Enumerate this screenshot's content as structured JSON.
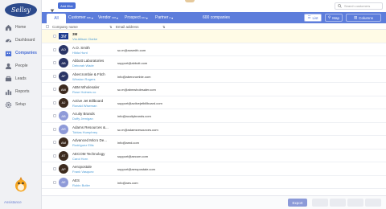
{
  "app": {
    "logo_text": "Sellsy",
    "help_link": "Assistance"
  },
  "sidebar": {
    "items": [
      {
        "label": "Home",
        "icon": "home-icon"
      },
      {
        "label": "Dashboard",
        "icon": "dashboard-icon"
      },
      {
        "label": "Companies",
        "icon": "companies-icon",
        "active": true
      },
      {
        "label": "People",
        "icon": "people-icon"
      },
      {
        "label": "Leads",
        "icon": "leads-icon"
      },
      {
        "label": "Reports",
        "icon": "reports-icon"
      },
      {
        "label": "Setup",
        "icon": "setup-icon"
      }
    ]
  },
  "toolbar": {
    "add_filter": "Add filter",
    "search_placeholder": "Search customers"
  },
  "tabs": [
    {
      "label": "All",
      "badge": ""
    },
    {
      "label": "Customer",
      "badge": "436"
    },
    {
      "label": "Vendor",
      "badge": "138"
    },
    {
      "label": "Prospect",
      "badge": "104"
    },
    {
      "label": "Partner",
      "badge": "2"
    }
  ],
  "count_label": "600 companies",
  "views": {
    "list": "List",
    "map": "Map",
    "columns": "Columns"
  },
  "table": {
    "columns": [
      "Company name",
      "Email address"
    ],
    "rows": [
      {
        "name": "3M",
        "contact": "Via Allison Clarke",
        "email": "",
        "avatar": "3M"
      },
      {
        "name": "A.O. Smith",
        "contact": "Hilda Hunt",
        "email": "sc.m@aosmith.com",
        "avatar": "AO"
      },
      {
        "name": "Abbott Laboratories",
        "contact": "Deborah Wade",
        "email": "support@abbott.com",
        "avatar": "AB"
      },
      {
        "name": "Abercrombie & Fitch",
        "contact": "Winston Rogers",
        "email": "info@abercrombie.com",
        "avatar": "AF"
      },
      {
        "name": "ABM Wholesaler",
        "contact": "Rose Holmes co",
        "email": "sc.m@abmwholesaler.com",
        "avatar": "AW"
      },
      {
        "name": "Active Jet Billboard",
        "contact": "Ronald Wiseman",
        "email": "support@activejetbillboard.com",
        "avatar": "AJ"
      },
      {
        "name": "Acuity Brands",
        "contact": "Duffy Jernigan",
        "email": "info@acuitybrands.com",
        "avatar": "AB"
      },
      {
        "name": "Adams Resources &...",
        "contact": "Tobias Humphrey",
        "email": "sc.m@adamsresources.com",
        "avatar": "AR"
      },
      {
        "name": "Advanced Micro De...",
        "contact": "Rodriguez Ellis",
        "email": "info@amd.com",
        "avatar": "AM"
      },
      {
        "name": "AECOM Technology",
        "contact": "Carol Horn",
        "email": "support@aecom.com",
        "avatar": "AT"
      },
      {
        "name": "Aeropostale",
        "contact": "Frank Vasquez",
        "email": "support@aeropostale.com",
        "avatar": "AP"
      },
      {
        "name": "AES",
        "contact": "Rubin Butler",
        "email": "info@aes.com",
        "avatar": "AE"
      }
    ]
  },
  "footer": {
    "export": "Export"
  },
  "colors": {
    "accent": "#5d7ddb",
    "link": "#4a9bd6"
  }
}
